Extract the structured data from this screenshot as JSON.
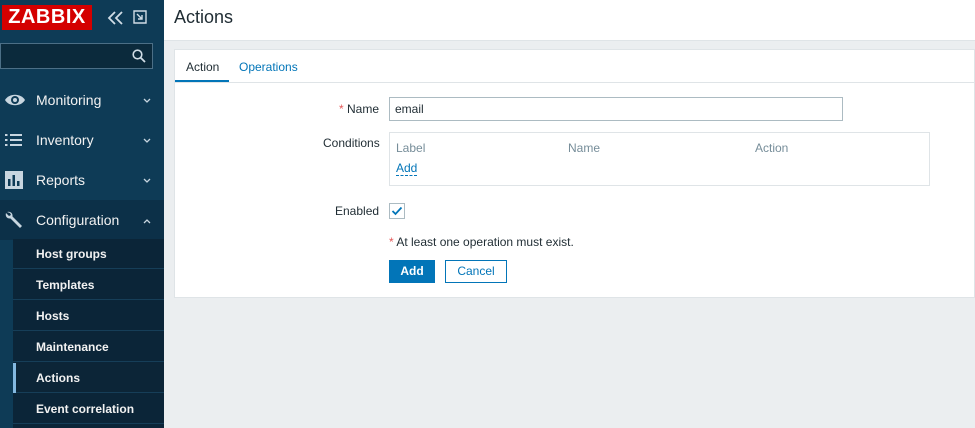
{
  "sidebar": {
    "logo": "ZABBIX",
    "search": {
      "value": "",
      "placeholder": ""
    },
    "menu": [
      {
        "label": "Monitoring",
        "icon": "eye-icon"
      },
      {
        "label": "Inventory",
        "icon": "list-icon"
      },
      {
        "label": "Reports",
        "icon": "bar-chart-icon"
      },
      {
        "label": "Configuration",
        "icon": "wrench-icon"
      }
    ],
    "submenu": [
      {
        "label": "Host groups"
      },
      {
        "label": "Templates"
      },
      {
        "label": "Hosts"
      },
      {
        "label": "Maintenance"
      },
      {
        "label": "Actions",
        "selected": true
      },
      {
        "label": "Event correlation"
      }
    ]
  },
  "page": {
    "title": "Actions"
  },
  "tabs": [
    {
      "label": "Action",
      "active": true
    },
    {
      "label": "Operations",
      "active": false
    }
  ],
  "form": {
    "name_label": "Name",
    "required_mark": "*",
    "name_value": "email",
    "conditions_label": "Conditions",
    "conditions_columns": [
      "Label",
      "Name",
      "Action"
    ],
    "conditions_add": "Add",
    "enabled_label": "Enabled",
    "enabled_checked": true,
    "warning_mark": "*",
    "warning_text": "At least one operation must exist.",
    "add_button": "Add",
    "cancel_button": "Cancel"
  },
  "colors": {
    "sidebar_bg": "#0e3b56",
    "logo_bg": "#d40000",
    "accent": "#0275b8",
    "required": "#e45959"
  }
}
